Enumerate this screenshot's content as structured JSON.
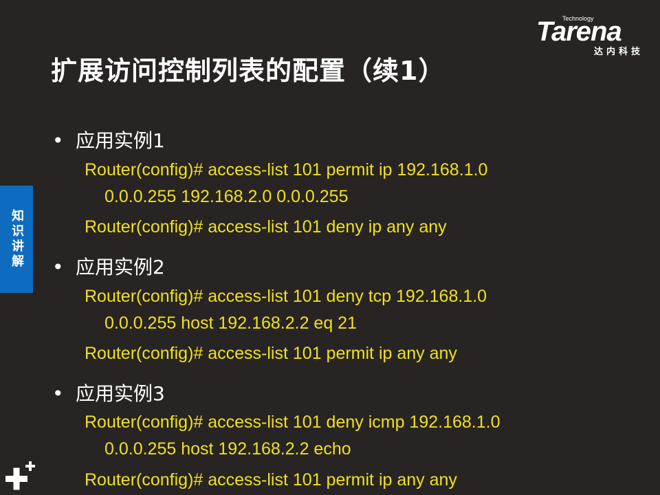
{
  "title": "扩展访问控制列表的配置（续1）",
  "logo": {
    "tagline": "Technology",
    "wordmark": "Tarena",
    "subtitle": "达内科技"
  },
  "side_tab": "知识讲解",
  "bullet_glyph": "•",
  "sections": [
    {
      "heading": "应用实例1",
      "lines": [
        "Router(config)# access-list 101 permit ip 192.168.1.0",
        "0.0.0.255 192.168.2.0 0.0.0.255",
        "Router(config)# access-list 101 deny ip any any"
      ]
    },
    {
      "heading": "应用实例2",
      "lines": [
        "Router(config)# access-list 101 deny tcp 192.168.1.0",
        "0.0.0.255 host 192.168.2.2 eq 21",
        "Router(config)# access-list 101 permit ip any any"
      ]
    },
    {
      "heading": "应用实例3",
      "lines": [
        "Router(config)# access-list 101 deny icmp 192.168.1.0",
        "0.0.0.255 host 192.168.2.2 echo",
        "Router(config)# access-list 101 permit ip any any"
      ]
    }
  ],
  "colors": {
    "background": "#272423",
    "command_text": "#f0e11c",
    "side_tab": "#0d6cc0"
  },
  "icons": [
    "plus-plus-icon"
  ]
}
